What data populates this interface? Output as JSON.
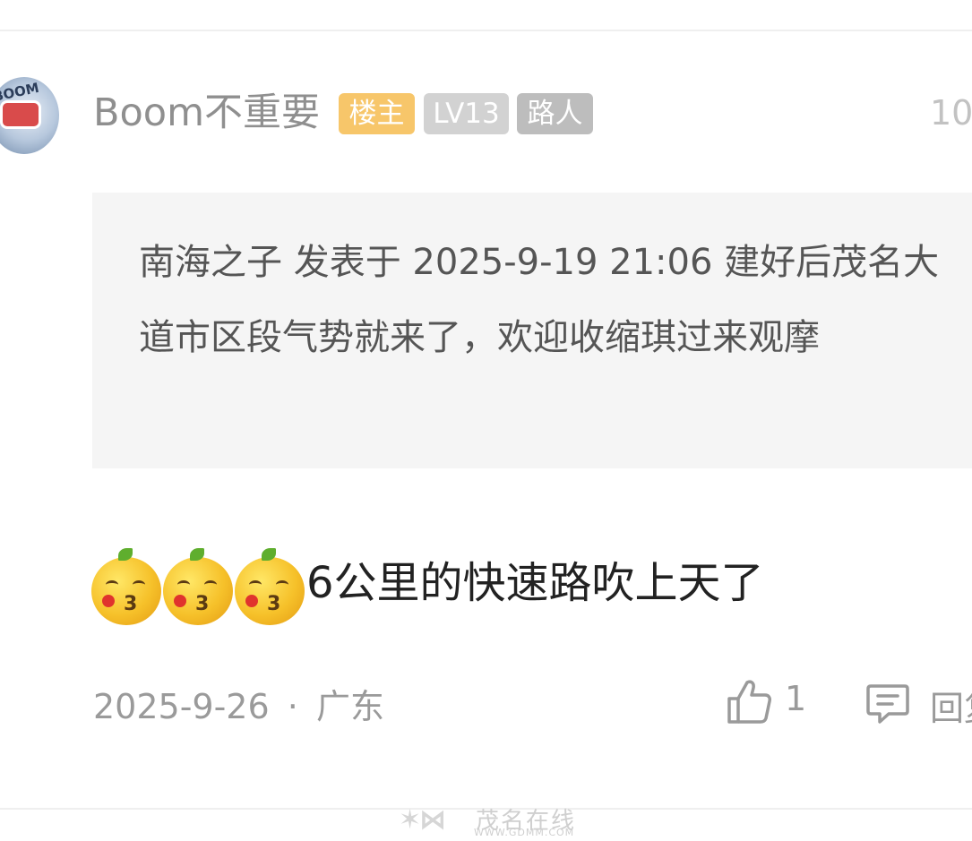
{
  "post": {
    "username": "Boom不重要",
    "badges": {
      "owner": "楼主",
      "level": "LV13",
      "role": "路人"
    },
    "time_partial": "10",
    "quote": "南海之子 发表于 2025-9-19 21:06 建好后茂名大道市区段气势就来了，欢迎收缩琪过来观摩",
    "reply_text": "6公里的快速路吹上天了",
    "date": "2025-9-26",
    "separator": "·",
    "location": "广东",
    "like_count": "1",
    "reply_label": "回复"
  },
  "watermark": {
    "cn": "茂名在线",
    "url": "WWW.GDMM.COM"
  },
  "icons": [
    "avatar",
    "emoji-kiss-orange",
    "thumb-up-icon",
    "comment-icon"
  ]
}
